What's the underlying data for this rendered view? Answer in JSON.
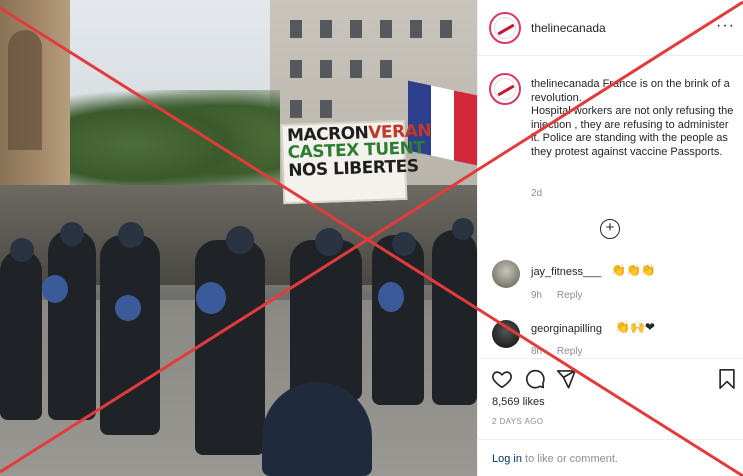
{
  "post": {
    "username": "thelinecanada",
    "more_label": "···",
    "photo": {
      "sign": {
        "line1_a": "MACRON",
        "line1_b": "VERAN",
        "line2": "CASTEX TUENT",
        "line3": "NOS LIBERTES"
      },
      "flag_colors": [
        "#2c3e8c",
        "#ffffff",
        "#d3273a"
      ]
    },
    "caption": {
      "username": "thelinecanada",
      "lines": [
        "France is on the brink of a revolution.",
        "Hospital workers are not only refusing the injection , they are refusing to administer it. Police are standing with the people as they protest against vaccine Passports."
      ],
      "time": "2d"
    },
    "load_more": "+",
    "comments": [
      {
        "username": "jay_fitness___",
        "text": "👏👏👏",
        "time": "9h",
        "reply": "Reply"
      },
      {
        "username": "georginapilling",
        "text": "👏🙌❤",
        "time": "8h",
        "reply": "Reply"
      }
    ],
    "actions": {
      "like_icon": "heart-icon",
      "comment_icon": "comment-icon",
      "share_icon": "share-icon",
      "save_icon": "bookmark-icon"
    },
    "likes": "8,569 likes",
    "date": "2 DAYS AGO",
    "login_prompt": {
      "link": "Log in",
      "rest": " to like or comment."
    }
  },
  "overlay": {
    "cross_color": "#e33b3b"
  }
}
